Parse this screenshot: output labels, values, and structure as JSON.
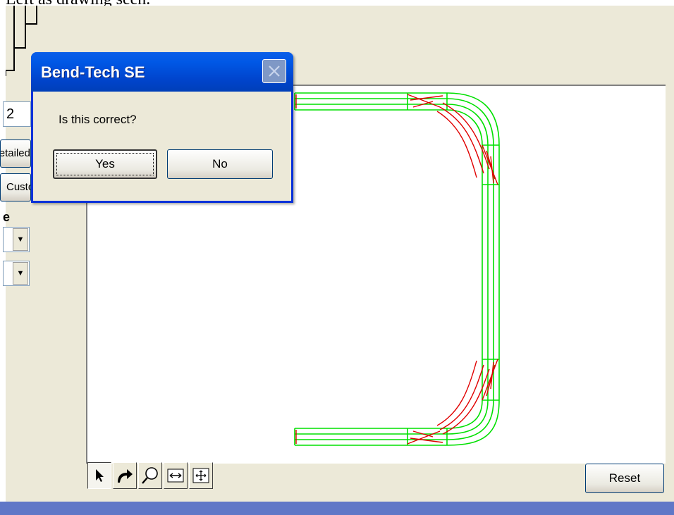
{
  "caption": "Left as drawing seen.",
  "side_panel": {
    "field_value": "2",
    "detailed_button_label": "Detailed",
    "custom_button_label": "Custom",
    "section_label": "e"
  },
  "toolbar": {
    "tools": [
      {
        "name": "select-arrow-icon",
        "active": true
      },
      {
        "name": "rotate-arrow-icon",
        "active": false
      },
      {
        "name": "zoom-magnifier-icon",
        "active": false
      },
      {
        "name": "measure-distance-icon",
        "active": false
      },
      {
        "name": "pan-move-icon",
        "active": false
      }
    ],
    "reset_label": "Reset"
  },
  "dialog": {
    "title": "Bend-Tech SE",
    "message": "Is this correct?",
    "yes_label": "Yes",
    "no_label": "No"
  },
  "colors": {
    "tube_outline": "#00e000",
    "bend_lines": "#e00000",
    "titlebar": "#0054e3",
    "bottom_band": "#6077c7"
  }
}
